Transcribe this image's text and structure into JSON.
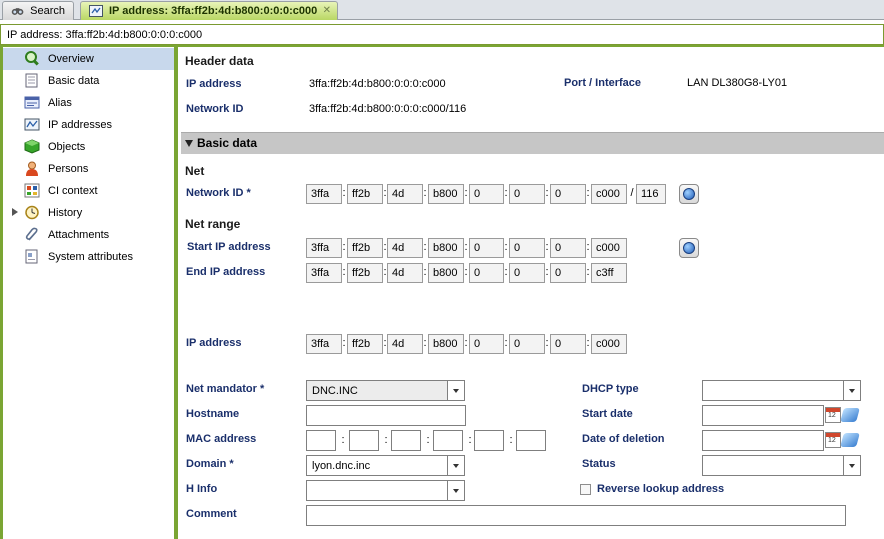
{
  "tabs": {
    "search_label": "Search",
    "active_label": "IP address: 3ffa:ff2b:4d:b800:0:0:0:c000",
    "close_label": "✕"
  },
  "address_line": "IP address: 3ffa:ff2b:4d:b800:0:0:0:c000",
  "sidebar": {
    "items": [
      {
        "label": "Overview",
        "icon": "magnifier-icon"
      },
      {
        "label": "Basic data",
        "icon": "document-icon"
      },
      {
        "label": "Alias",
        "icon": "alias-card-icon"
      },
      {
        "label": "IP addresses",
        "icon": "ip-addresses-icon"
      },
      {
        "label": "Objects",
        "icon": "green-cube-icon"
      },
      {
        "label": "Persons",
        "icon": "person-icon"
      },
      {
        "label": "CI context",
        "icon": "ci-context-icon"
      },
      {
        "label": "History",
        "icon": "history-clock-icon"
      },
      {
        "label": "Attachments",
        "icon": "paperclip-icon"
      },
      {
        "label": "System attributes",
        "icon": "system-attributes-icon"
      }
    ]
  },
  "header": {
    "title": "Header data",
    "ip_label": "IP address",
    "ip_value": "3ffa:ff2b:4d:b800:0:0:0:c000",
    "network_label": "Network ID",
    "network_value": "3ffa:ff2b:4d:b800:0:0:0:c000/116",
    "port_label": "Port / Interface",
    "port_value": "LAN DL380G8-LY01"
  },
  "basic": {
    "section_title": "Basic data",
    "net_heading": "Net",
    "network_id_label": "Network ID *",
    "network_id": [
      "3ffa",
      "ff2b",
      "4d",
      "b800",
      "0",
      "0",
      "0",
      "c000"
    ],
    "network_prefix": "116",
    "net_range_heading": "Net range",
    "start_label": "Start IP address",
    "start_ip": [
      "3ffa",
      "ff2b",
      "4d",
      "b800",
      "0",
      "0",
      "0",
      "c000"
    ],
    "end_label": "End IP address",
    "end_ip": [
      "3ffa",
      "ff2b",
      "4d",
      "b800",
      "0",
      "0",
      "0",
      "c3ff"
    ],
    "ip_label": "IP address",
    "ip": [
      "3ffa",
      "ff2b",
      "4d",
      "b800",
      "0",
      "0",
      "0",
      "c000"
    ],
    "net_mandator_label": "Net mandator *",
    "net_mandator_value": "DNC.INC",
    "hostname_label": "Hostname",
    "hostname_value": "",
    "mac_label": "MAC address",
    "domain_label": "Domain *",
    "domain_value": "lyon.dnc.inc",
    "hinfo_label": "H Info",
    "hinfo_value": "",
    "comment_label": "Comment",
    "comment_value": "",
    "dhcp_label": "DHCP type",
    "dhcp_value": "",
    "start_date_label": "Start date",
    "deletion_label": "Date of deletion",
    "status_label": "Status",
    "status_value": "",
    "reverse_label": "Reverse lookup address",
    "calendar_day": "12"
  }
}
